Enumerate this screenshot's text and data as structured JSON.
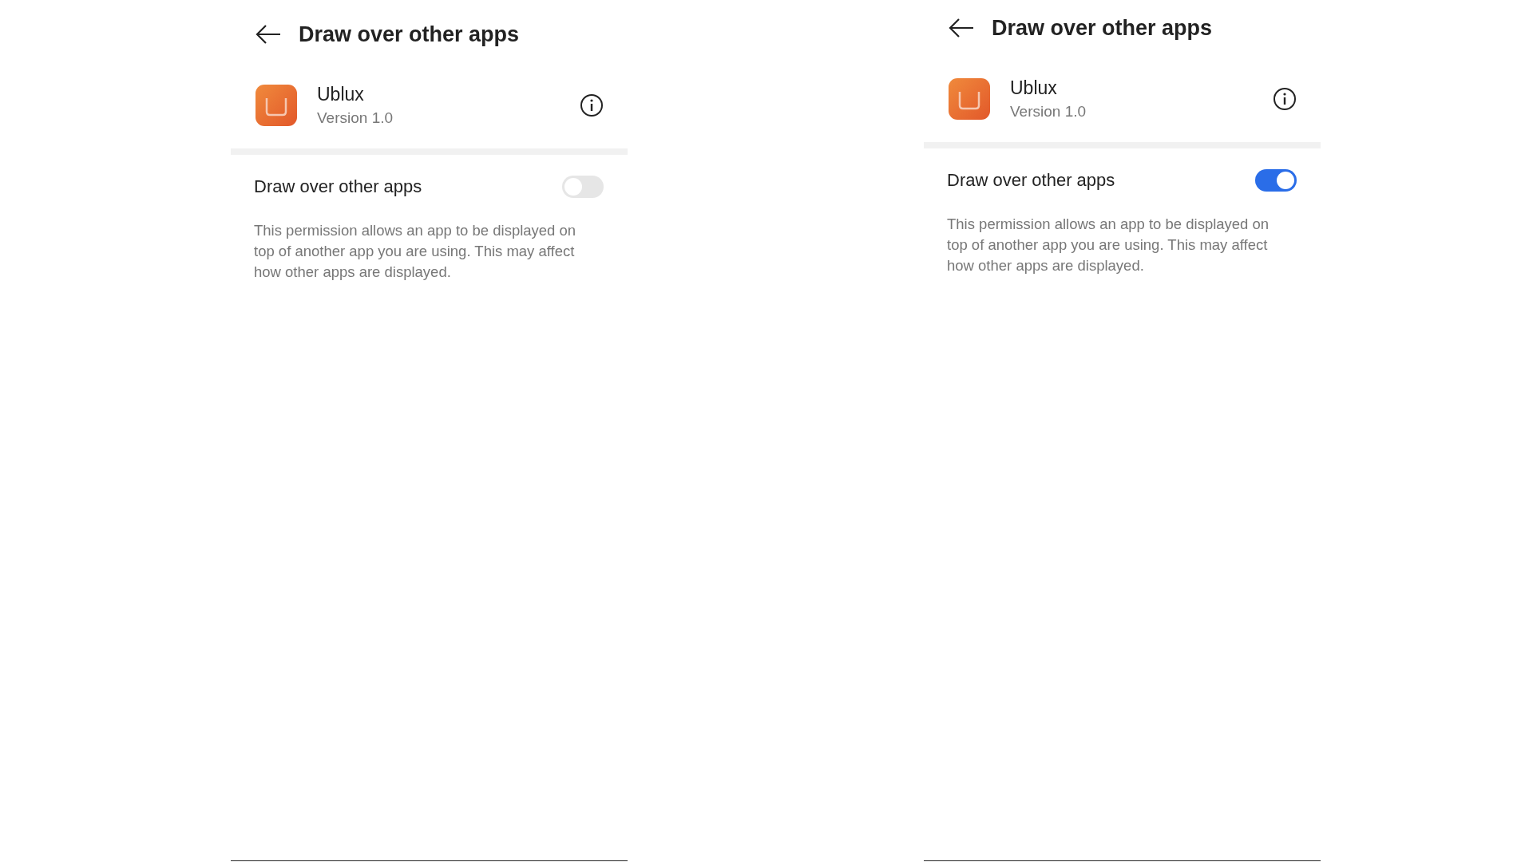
{
  "screens": [
    {
      "title": "Draw over other apps",
      "app": {
        "name": "Ublux",
        "version": "Version 1.0"
      },
      "setting": {
        "label": "Draw over other apps",
        "on": false
      },
      "description": "This permission allows an app to be displayed on top of another app you are using. This may affect how other apps are displayed."
    },
    {
      "title": "Draw over other apps",
      "app": {
        "name": "Ublux",
        "version": "Version 1.0"
      },
      "setting": {
        "label": "Draw over other apps",
        "on": true
      },
      "description": "This permission allows an app to be displayed on top of another app you are using. This may affect how other apps are displayed."
    }
  ]
}
